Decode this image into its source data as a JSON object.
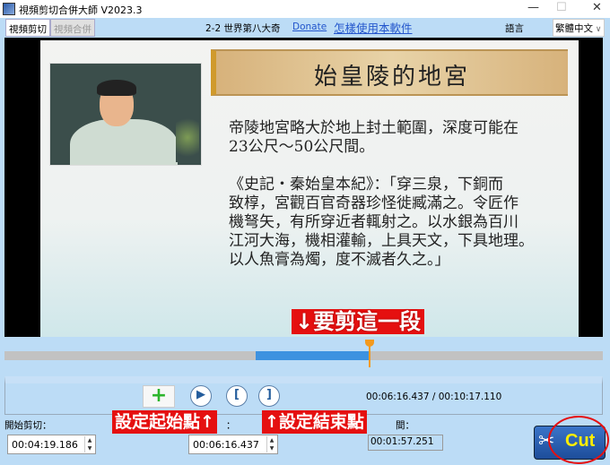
{
  "window": {
    "title": "視頻剪切合併大師 V2023.3",
    "minimize": "—",
    "maximize": "☐",
    "close": "✕"
  },
  "toolbar": {
    "tab_cut": "視頻剪切",
    "tab_merge": "視頻合併",
    "lesson": "2-2 世界第八大奇",
    "donate": "Donate",
    "help": "怎樣使用本軟件",
    "lang_label": "語言",
    "lang_value": "繁體中文"
  },
  "slide": {
    "title": "始皇陵的地宮",
    "body": "帝陵地宮略大於地上封土範圍，深度可能在\n23公尺～50公尺間。\n\n《史記・秦始皇本紀》：「穿三泉，下銅而\n致椁，宮觀百官奇器珍怪徙臧滿之。令匠作\n機弩矢，有所穿近者輒射之。以水銀為百川\n江河大海，機相灌輸，上具天文，下具地理。\n以人魚膏為燭，度不滅者久之。」"
  },
  "timeline": {
    "start": "00:04:19.186",
    "end": "00:06:16.437",
    "current": "00:06:16.437",
    "total": "00:10:17.110",
    "readout": "00:06:16.437 / 00:10:17.110"
  },
  "controls": {
    "add": "+",
    "play": "▶",
    "mark_in": "[",
    "mark_out": "]"
  },
  "fields": {
    "start_label": "開始剪切：",
    "start_value": "00:04:19.186",
    "end_label": "：",
    "end_value": "00:06:16.437",
    "duration_label": "間：",
    "duration_value": "00:01:57.251"
  },
  "cut": {
    "label": "Cut"
  },
  "annotations": {
    "segment": "↓要剪這一段",
    "set_start": "設定起始點↑",
    "set_end": "↑設定結束點",
    "color": "#e51010"
  }
}
